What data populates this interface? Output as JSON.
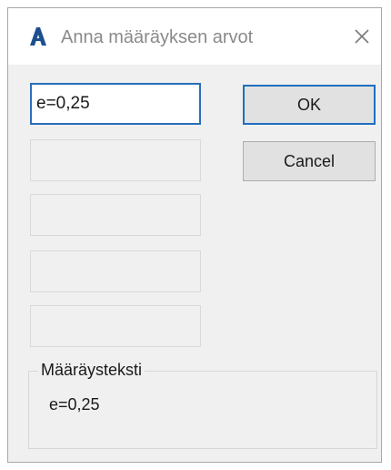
{
  "window": {
    "title": "Anna määräyksen arvot",
    "icon": "autocad-a-icon",
    "close_icon": "close-icon"
  },
  "fields": [
    {
      "value": "e=0,25",
      "active": true
    },
    {
      "value": "",
      "active": false
    },
    {
      "value": "",
      "active": false
    },
    {
      "value": "",
      "active": false
    },
    {
      "value": "",
      "active": false
    }
  ],
  "buttons": {
    "ok_label": "OK",
    "cancel_label": "Cancel"
  },
  "group": {
    "label": "Määräysteksti",
    "text": "e=0,25"
  },
  "colors": {
    "accent": "#1f6fc0",
    "app_icon": "#1d4f8f",
    "background": "#f0f0f0"
  }
}
